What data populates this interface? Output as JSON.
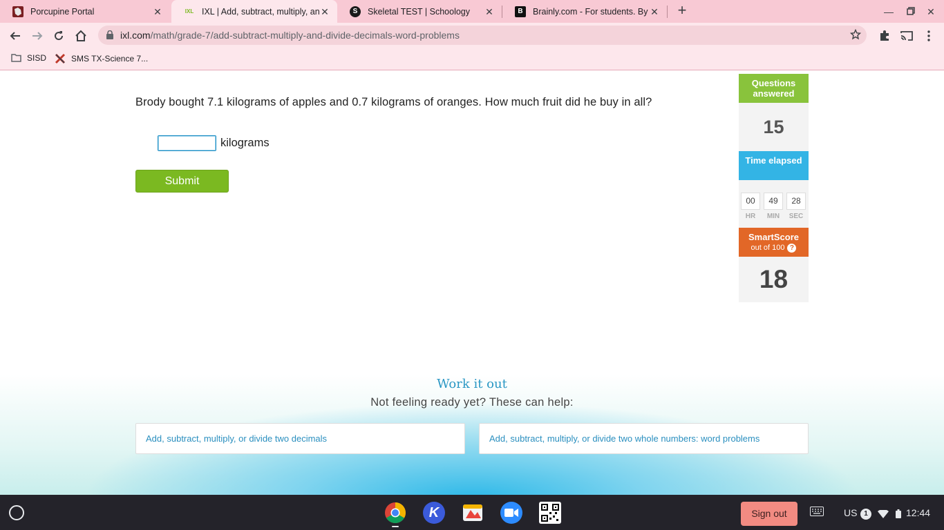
{
  "browser": {
    "tabs": [
      {
        "title": "Porcupine Portal",
        "active": false
      },
      {
        "title": "IXL | Add, subtract, multiply, and",
        "active": true
      },
      {
        "title": "Skeletal TEST | Schoology",
        "active": false
      },
      {
        "title": "Brainly.com - For students. By st",
        "active": false
      }
    ],
    "favicons": {
      "ixl": "IXL",
      "brainly": "B",
      "schoology": "S"
    },
    "url_domain": "ixl.com",
    "url_path": "/math/grade-7/add-subtract-multiply-and-divide-decimals-word-problems",
    "bookmarks": [
      {
        "label": "SISD",
        "icon": "folder-icon"
      },
      {
        "label": "SMS TX-Science 7...",
        "icon": "x-logo-icon"
      }
    ]
  },
  "question": {
    "text": "Brody bought 7.1 kilograms of apples and 0.7 kilograms of oranges. How much fruit did he buy in all?",
    "answer_value": "",
    "unit": "kilograms",
    "submit_label": "Submit"
  },
  "stats": {
    "questions_label": "Questions answered",
    "questions_value": "15",
    "time_label": "Time elapsed",
    "time": {
      "hr": "00",
      "min": "49",
      "sec": "28"
    },
    "time_units": {
      "hr": "HR",
      "min": "MIN",
      "sec": "SEC"
    },
    "smartscore_label": "SmartScore",
    "smartscore_sub": "out of 100",
    "smartscore_help": "?",
    "smartscore_value": "18"
  },
  "help": {
    "title": "Work it out",
    "subtitle": "Not feeling ready yet? These can help:",
    "links": [
      "Add, subtract, multiply, or divide two decimals",
      "Add, subtract, multiply, or divide two whole numbers: word problems"
    ]
  },
  "shelf": {
    "signout_label": "Sign out",
    "ime": "US",
    "notifications": "1",
    "clock": "12:44",
    "zoom_glyph": "K"
  },
  "colors": {
    "tabstrip": "#f8c9d4",
    "ixl_green": "#89c33c",
    "ixl_blue": "#33b4e5",
    "ixl_orange": "#e26727",
    "submit_green": "#7bb921"
  }
}
